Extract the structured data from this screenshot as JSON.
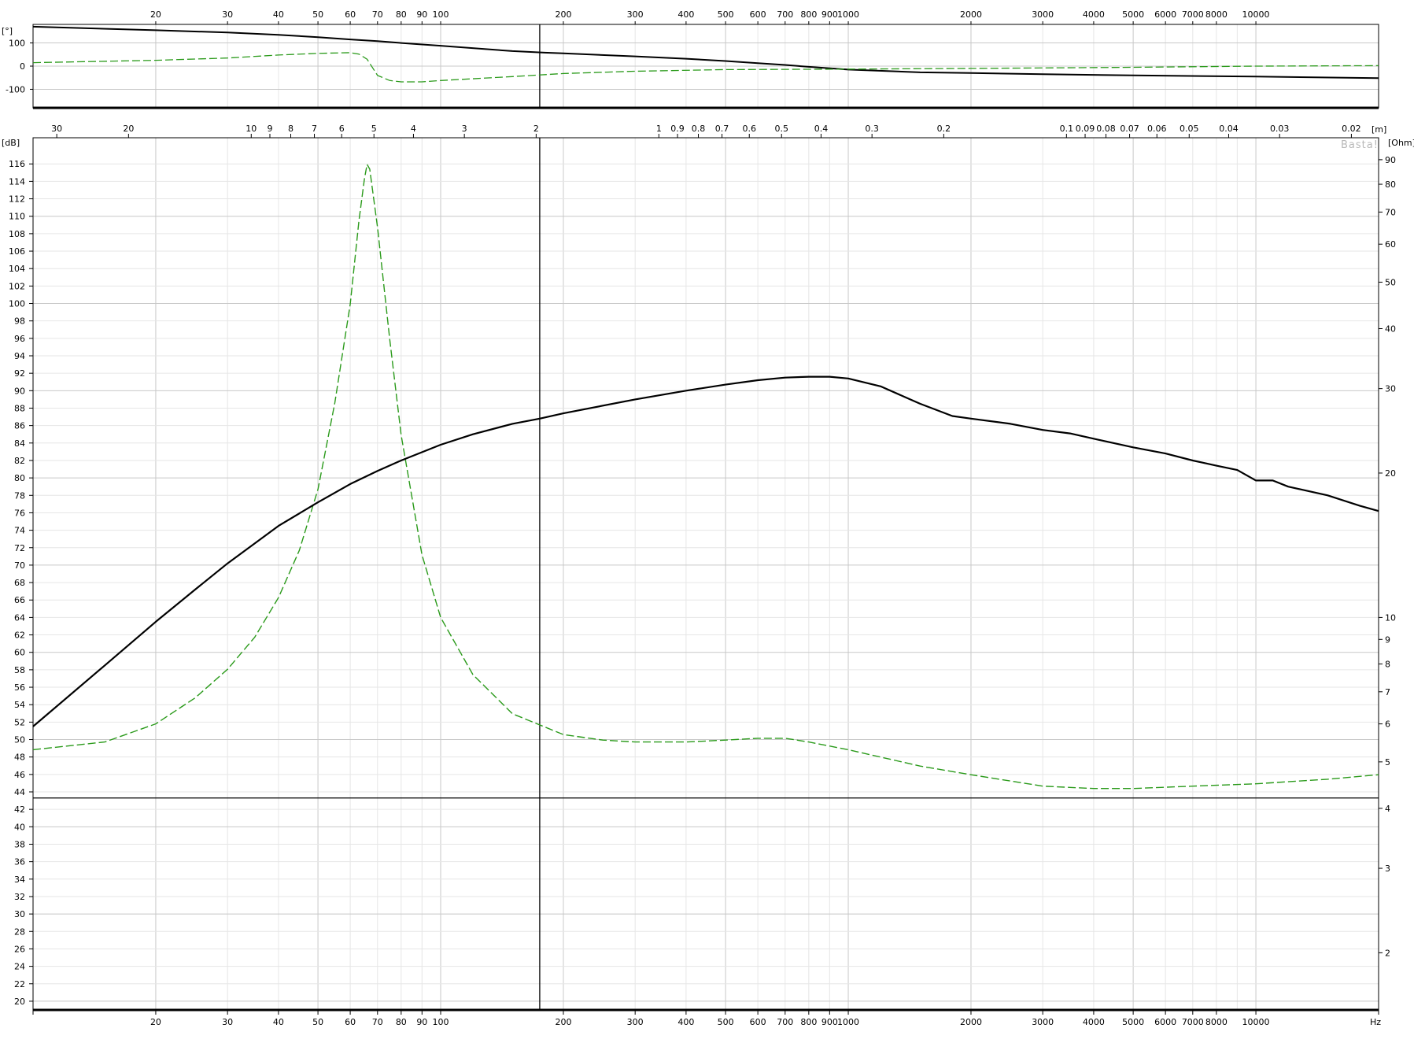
{
  "units": {
    "phase": "[°]",
    "spl": "[dB]",
    "impedance": "[Ohm]",
    "distance": "[m]",
    "frequency": "Hz"
  },
  "watermark": "Basta!",
  "colors": {
    "spl": "#000000",
    "impedance": "#2a9a1a",
    "grid_major": "#c8c8c8",
    "grid_minor": "#e6e6e6"
  },
  "chart_data": [
    {
      "type": "line",
      "panel": "phase",
      "xscale": "log",
      "xlim": [
        10,
        20000
      ],
      "ylim": [
        -180,
        180
      ],
      "x_ticks": [
        20,
        30,
        40,
        50,
        60,
        70,
        80,
        90,
        100,
        200,
        300,
        400,
        500,
        600,
        700,
        800,
        900,
        1000,
        2000,
        3000,
        4000,
        5000,
        6000,
        7000,
        8000,
        10000
      ],
      "y_ticks": [
        100,
        0,
        -100
      ],
      "grid": true,
      "series": [
        {
          "x": [
            10,
            20,
            30,
            40,
            50,
            60,
            70,
            80,
            100,
            150,
            180,
            200,
            300,
            400,
            500,
            600,
            700,
            800,
            1000,
            1500,
            2000,
            3000,
            5000,
            10000,
            20000
          ],
          "y": [
            170,
            155,
            145,
            135,
            125,
            115,
            108,
            100,
            88,
            65,
            58,
            55,
            42,
            32,
            22,
            13,
            5,
            -3,
            -15,
            -27,
            -30,
            -35,
            -40,
            -45,
            -52
          ]
        },
        {
          "x": [
            10,
            20,
            30,
            40,
            50,
            60,
            63,
            66,
            70,
            75,
            80,
            90,
            100,
            150,
            200,
            300,
            500,
            1000,
            2000,
            5000,
            10000,
            20000
          ],
          "y": [
            15,
            25,
            35,
            48,
            55,
            58,
            52,
            30,
            -40,
            -62,
            -68,
            -68,
            -62,
            -45,
            -32,
            -22,
            -15,
            -13,
            -10,
            -5,
            0,
            2
          ]
        }
      ]
    },
    {
      "type": "line",
      "panel": "main",
      "xscale": "log",
      "xlim": [
        10,
        20000
      ],
      "ylim": [
        19,
        119
      ],
      "y2scale": "log",
      "y2lim": [
        1.52,
        100
      ],
      "x_ticks": [
        20,
        30,
        40,
        50,
        60,
        70,
        80,
        90,
        100,
        200,
        300,
        400,
        500,
        600,
        700,
        800,
        900,
        1000,
        2000,
        3000,
        4000,
        5000,
        6000,
        7000,
        8000,
        10000
      ],
      "y_ticks": [
        20,
        22,
        24,
        26,
        28,
        30,
        32,
        34,
        36,
        38,
        40,
        42,
        44,
        46,
        48,
        50,
        52,
        54,
        56,
        58,
        60,
        62,
        64,
        66,
        68,
        70,
        72,
        74,
        76,
        78,
        80,
        82,
        84,
        86,
        88,
        90,
        92,
        94,
        96,
        98,
        100,
        102,
        104,
        106,
        108,
        110,
        112,
        114,
        116
      ],
      "y2_ticks": [
        2,
        3,
        4,
        5,
        6,
        7,
        8,
        9,
        10,
        20,
        30,
        40,
        50,
        60,
        70,
        80,
        90
      ],
      "distance_ticks": [
        "30",
        "20",
        "10",
        "9",
        "8",
        "7",
        "6",
        "5",
        "4",
        "3",
        "2",
        "1",
        "0.9",
        "0.8",
        "0.7",
        "0.6",
        "0.5",
        "0.4",
        "0.3",
        "0.2",
        "0.1",
        "0.09",
        "0.08",
        "0.07",
        "0.06",
        "0.05",
        "0.04",
        "0.03",
        "0.02"
      ],
      "cursor_x": 175,
      "reference_line_y": 43.3,
      "grid": true,
      "series": [
        {
          "axis": "left",
          "x": [
            10,
            15,
            20,
            25,
            30,
            40,
            50,
            60,
            70,
            80,
            100,
            120,
            150,
            175,
            200,
            300,
            400,
            500,
            600,
            700,
            800,
            900,
            1000,
            1200,
            1500,
            1800,
            2000,
            2500,
            3000,
            3500,
            4000,
            5000,
            6000,
            7000,
            8000,
            9000,
            10000,
            11000,
            12000,
            15000,
            18000,
            20000
          ],
          "y": [
            51.5,
            58.5,
            63.5,
            67.2,
            70.2,
            74.5,
            77.2,
            79.3,
            80.8,
            82,
            83.8,
            85,
            86.2,
            86.8,
            87.4,
            89,
            90,
            90.7,
            91.2,
            91.5,
            91.6,
            91.6,
            91.4,
            90.5,
            88.5,
            87.1,
            86.8,
            86.2,
            85.5,
            85.1,
            84.5,
            83.5,
            82.8,
            82,
            81.4,
            80.9,
            79.7,
            79.7,
            79,
            78,
            76.8,
            76.2
          ]
        },
        {
          "axis": "right",
          "x": [
            10,
            15,
            20,
            25,
            30,
            35,
            40,
            45,
            50,
            55,
            60,
            63,
            65,
            66,
            67,
            70,
            75,
            80,
            90,
            100,
            120,
            150,
            200,
            250,
            300,
            400,
            500,
            600,
            700,
            800,
            1000,
            1500,
            2000,
            3000,
            4000,
            5000,
            7000,
            10000,
            15000,
            20000
          ],
          "y": [
            5.3,
            5.5,
            6.0,
            6.8,
            7.8,
            9.1,
            11.0,
            13.8,
            18.5,
            28,
            45,
            67,
            82,
            88,
            86,
            65,
            38,
            24,
            13.5,
            10.0,
            7.6,
            6.3,
            5.7,
            5.55,
            5.5,
            5.5,
            5.55,
            5.6,
            5.6,
            5.5,
            5.3,
            4.9,
            4.7,
            4.45,
            4.4,
            4.4,
            4.45,
            4.5,
            4.6,
            4.7
          ]
        }
      ]
    }
  ]
}
